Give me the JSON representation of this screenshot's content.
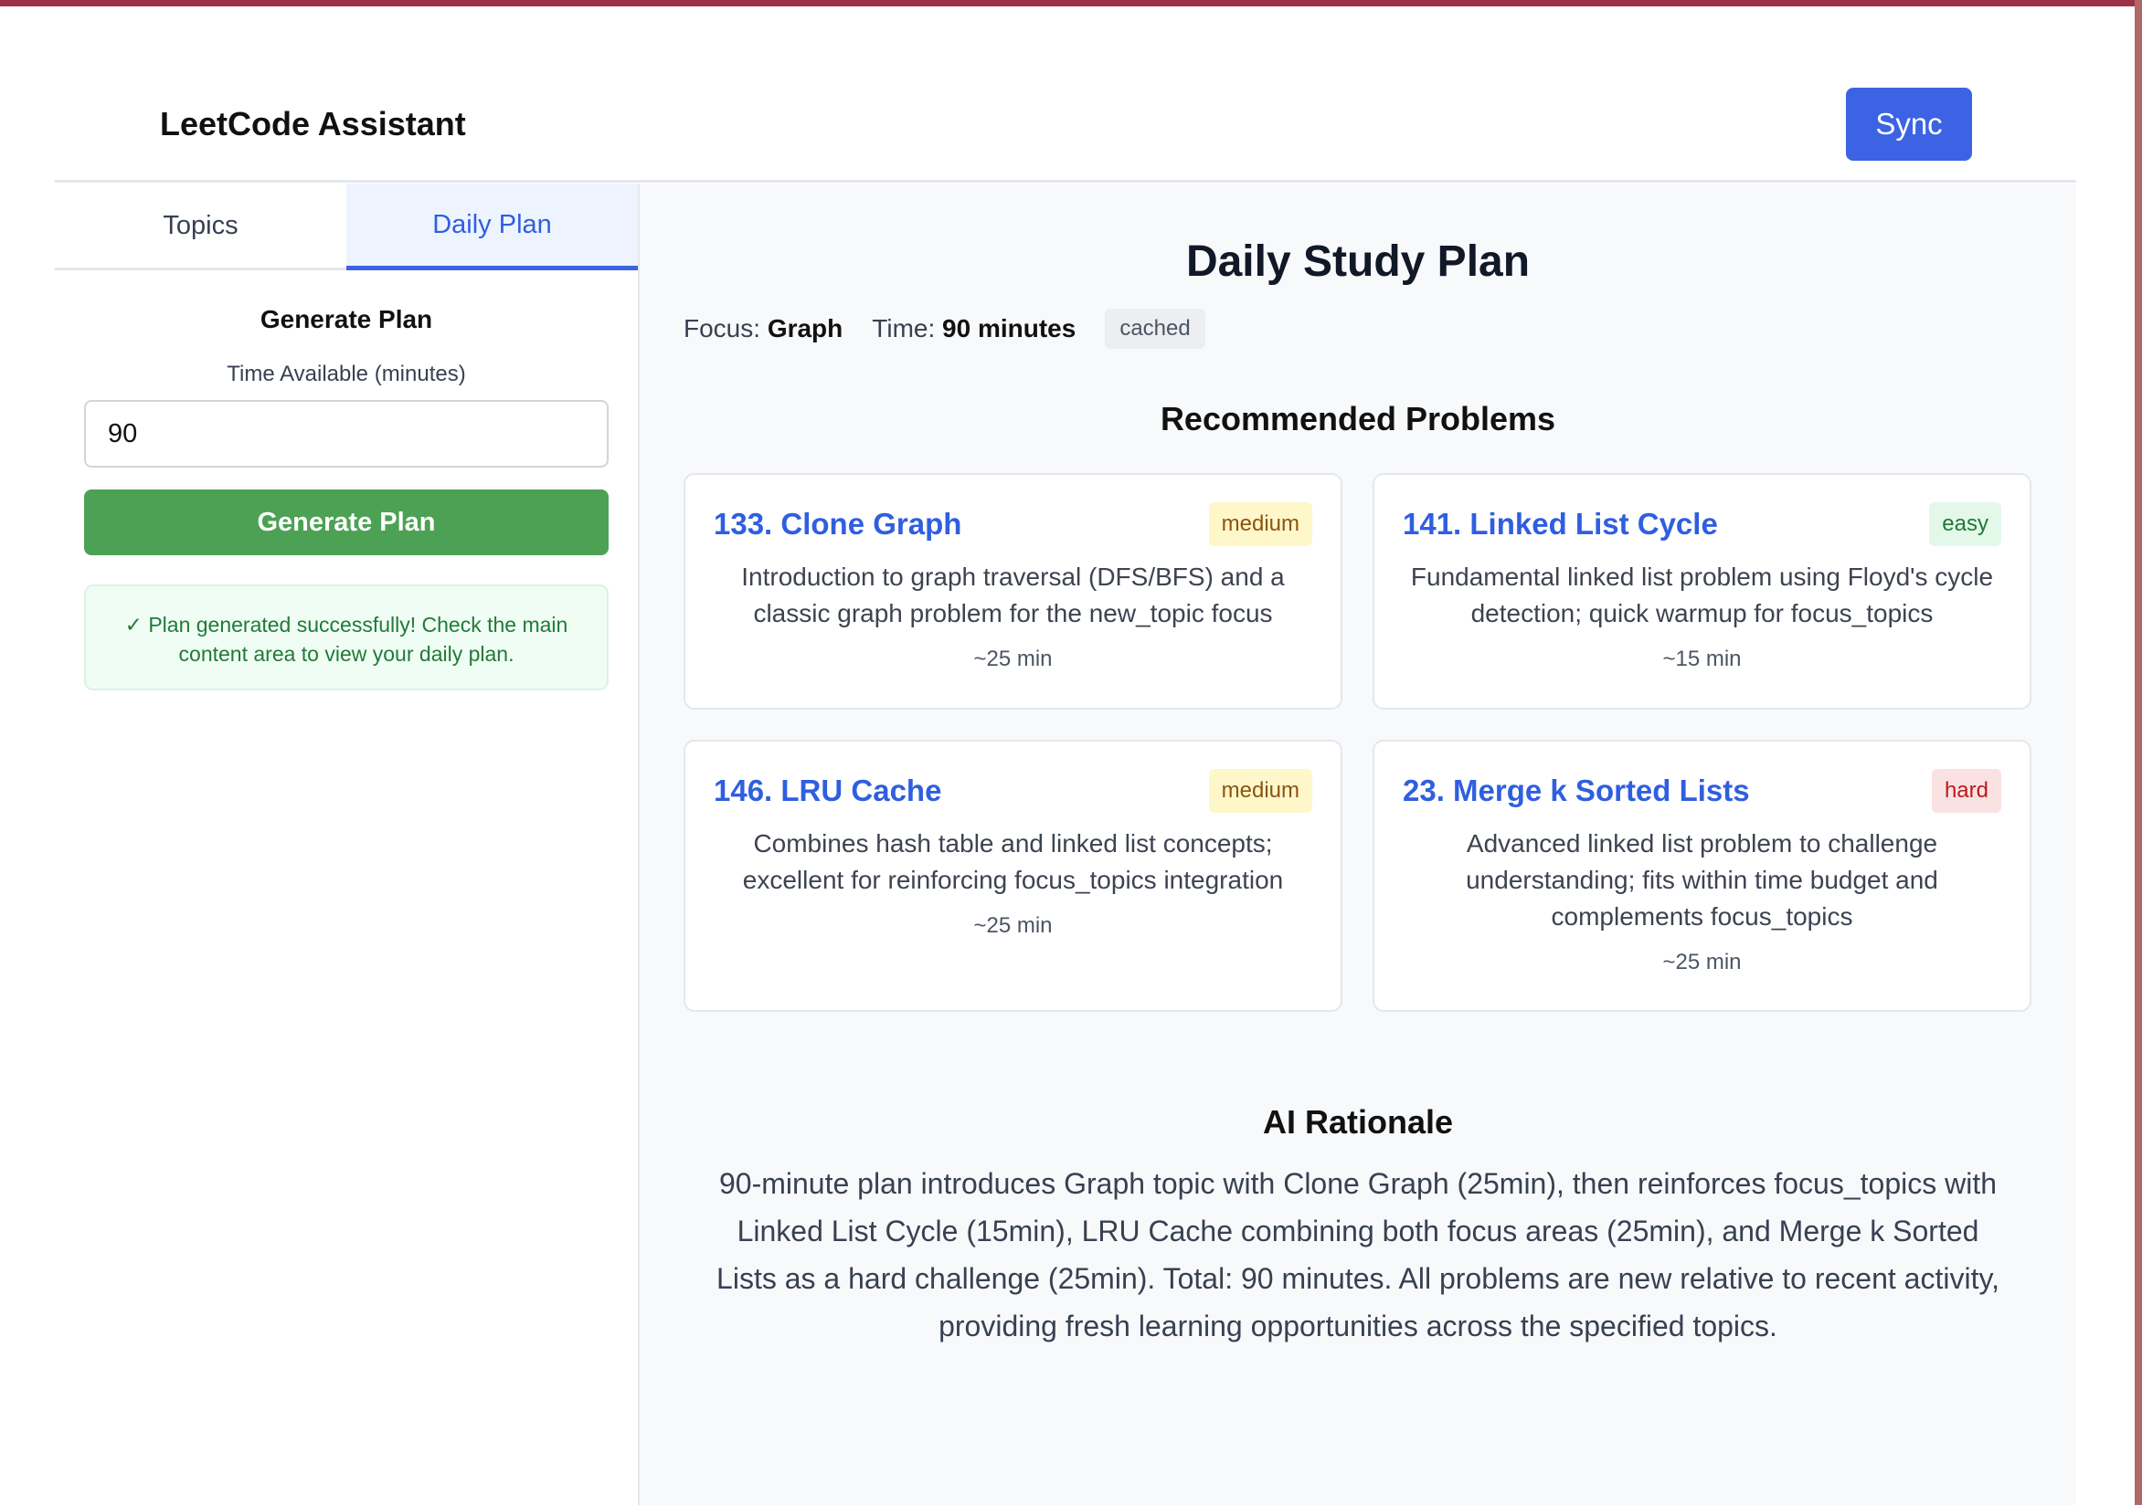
{
  "header": {
    "title": "LeetCode Assistant",
    "sync_label": "Sync"
  },
  "sidebar": {
    "tabs": [
      {
        "label": "Topics",
        "active": false
      },
      {
        "label": "Daily Plan",
        "active": true
      }
    ],
    "heading": "Generate Plan",
    "time_label": "Time Available (minutes)",
    "time_value": "90",
    "generate_label": "Generate Plan",
    "success_message": "✓ Plan generated successfully! Check the main content area to view your daily plan."
  },
  "main": {
    "title": "Daily Study Plan",
    "focus_label": "Focus:",
    "focus_value": "Graph",
    "time_label": "Time:",
    "time_value": "90 minutes",
    "cached_badge": "cached",
    "problems_heading": "Recommended Problems",
    "problems": [
      {
        "title": "133. Clone Graph",
        "difficulty": "medium",
        "description": "Introduction to graph traversal (DFS/BFS) and a classic graph problem for the new_topic focus",
        "time": "~25 min"
      },
      {
        "title": "141. Linked List Cycle",
        "difficulty": "easy",
        "description": "Fundamental linked list problem using Floyd's cycle detection; quick warmup for focus_topics",
        "time": "~15 min"
      },
      {
        "title": "146. LRU Cache",
        "difficulty": "medium",
        "description": "Combines hash table and linked list concepts; excellent for reinforcing focus_topics integration",
        "time": "~25 min"
      },
      {
        "title": "23. Merge k Sorted Lists",
        "difficulty": "hard",
        "description": "Advanced linked list problem to challenge understanding; fits within time budget and complements focus_topics",
        "time": "~25 min"
      }
    ],
    "rationale_heading": "AI Rationale",
    "rationale": "90-minute plan introduces Graph topic with Clone Graph (25min), then reinforces focus_topics with Linked List Cycle (15min), LRU Cache combining both focus areas (25min), and Merge k Sorted Lists as a hard challenge (25min). Total: 90 minutes. All problems are new relative to recent activity, providing fresh learning opportunities across the specified topics."
  },
  "colors": {
    "accent": "#3b63e3",
    "success": "#4ca154",
    "window_frame": "#9b3344"
  }
}
